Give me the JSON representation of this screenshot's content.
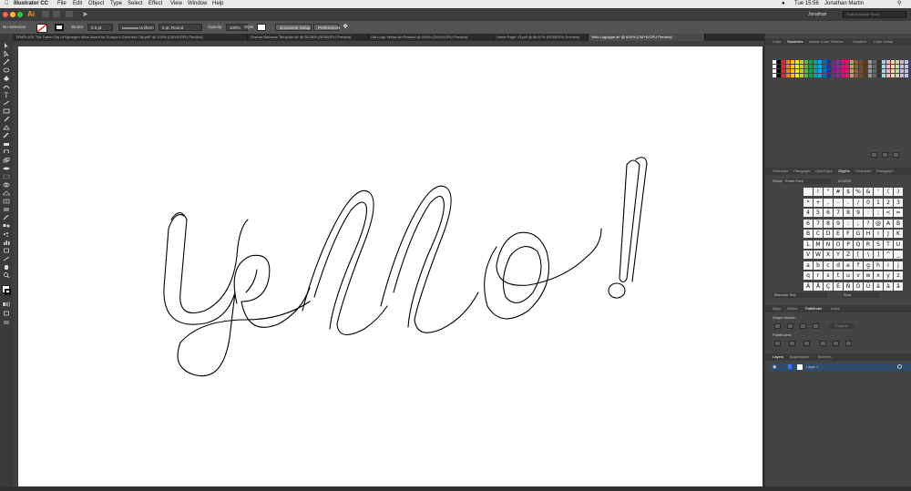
{
  "menubar": {
    "app": "Illustrator CC",
    "menus": [
      "File",
      "Edit",
      "Object",
      "Type",
      "Select",
      "Effect",
      "View",
      "Window",
      "Help"
    ],
    "clock": "Tue 15:56",
    "user": "Jonathan Martin"
  },
  "appbar": {
    "logo": "Ai",
    "workspace_user": "Jonathan",
    "search_placeholder": "Search Adobe Stock"
  },
  "controlbar": {
    "selection": "No Selection",
    "stroke_label": "Stroke:",
    "stroke_weight": "0.5 pt",
    "brush": "Uniform",
    "profile": "5 pt. Round",
    "opacity_label": "Opacity:",
    "opacity_value": "100%",
    "style_label": "Style:",
    "document_setup": "Document Setup",
    "preferences": "Preferences"
  },
  "tabs": [
    "TEMPLATE The Dutch City of Nijmegen Wins Award for Europe's Greenest City.pdf* @ 133% (CMYK/GPU Preview)",
    "Orshon Behance Template.ai* @ 55.28% (RGB/GPU Preview)",
    "Old Logo Yellow Art Printout @ 200% (CMYK/GPU Preview)",
    "Home Page V3.pdf @ 66.67% (RGB/GPU Preview)",
    "Yello Logotype.ai* @ 600% (CMYK/GPU Preview)"
  ],
  "artwork": {
    "word": "yello!",
    "description_color": "#000000"
  },
  "panel": {
    "color_tabs": [
      "Color",
      "Swatches",
      "Adobe Color Themes",
      "Gradient",
      "Color Guide"
    ],
    "type_tabs": [
      "Character",
      "Paragraph",
      "OpenType",
      "Glyphs",
      "Character",
      "Paragraph"
    ],
    "glyphs_show_label": "Show:",
    "glyphs_show_value": "Entire Font",
    "glyphs_code": "U+0025",
    "glyphs_rows": [
      [
        "",
        "!",
        "\"",
        "#",
        "$",
        "%",
        "&",
        "'",
        "(",
        ")"
      ],
      [
        "*",
        "+",
        ",",
        "-",
        ".",
        "/",
        "0",
        "1",
        "2",
        "3"
      ],
      [
        "4",
        "5",
        "6",
        "7",
        "8",
        "9",
        ":",
        ";",
        "<",
        "="
      ],
      [
        "6",
        "7",
        "8",
        "9",
        ":",
        ";",
        "?",
        "@",
        "A",
        "B"
      ],
      [
        "B",
        "C",
        "D",
        "E",
        "F",
        "G",
        "H",
        "I",
        "J",
        "K"
      ],
      [
        "L",
        "M",
        "N",
        "O",
        "P",
        "Q",
        "R",
        "S",
        "T",
        "U"
      ],
      [
        "V",
        "W",
        "X",
        "Y",
        "Z",
        "[",
        "\\",
        "]",
        "^",
        "_"
      ],
      [
        "a",
        "b",
        "c",
        "d",
        "e",
        "f",
        "g",
        "h",
        "i",
        "j"
      ],
      [
        "q",
        "r",
        "s",
        "t",
        "u",
        "v",
        "w",
        "x",
        "y",
        "z"
      ],
      [
        "Ä",
        "Å",
        "Ç",
        "É",
        "Ñ",
        "Ö",
        "Ü",
        "á",
        "à",
        "â"
      ]
    ],
    "font_name": "Brandon Text",
    "font_style": "Bold",
    "align_tabs": [
      "Align",
      "Stroke",
      "Pathfinder",
      "Links"
    ],
    "shape_modes_label": "Shape Modes:",
    "expand_label": "Expand",
    "pathfinders_label": "Pathfinders:",
    "layers_tabs": [
      "Layers",
      "Appearance",
      "Brushes"
    ],
    "layer_name": "Layer 1"
  },
  "colors": {
    "menubar_bg": "#e9e9e9",
    "app_bg": "#323232",
    "canvas_bg": "#ffffff",
    "accent_tab": "#4a4a4a",
    "layer_highlight": "#2d4c6e"
  }
}
